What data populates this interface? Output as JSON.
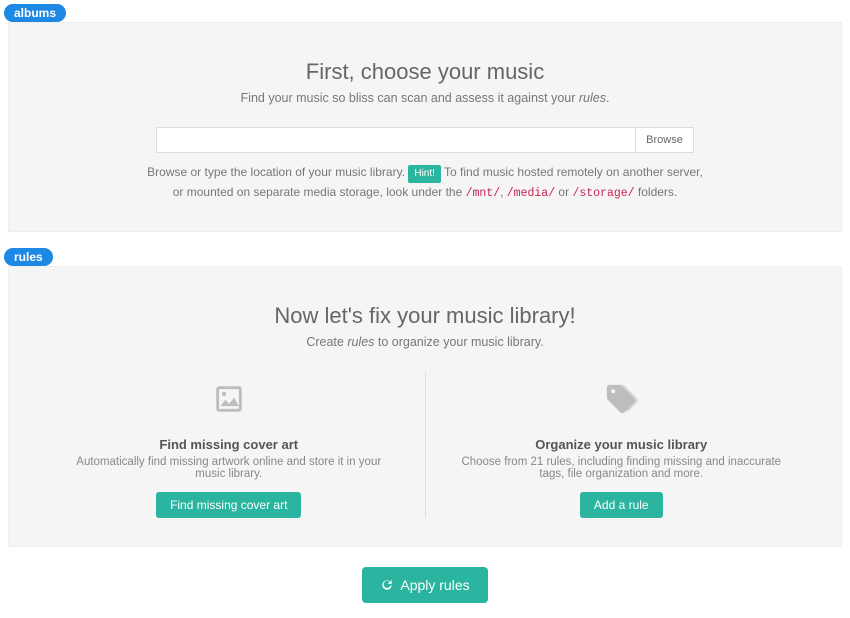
{
  "albums": {
    "tag": "albums",
    "title": "First, choose your music",
    "subtitle_pre": "Find your music so bliss can scan and assess it against your ",
    "subtitle_em": "rules",
    "subtitle_post": ".",
    "browse_label": "Browse",
    "hint_pre": "Browse or type the location of your music library. ",
    "hint_badge": "Hint!",
    "hint_mid": " To find music hosted remotely on another server, or mounted on separate media storage, look under the ",
    "path1": "/mnt/",
    "sep1": ", ",
    "path2": "/media/",
    "sep2": " or ",
    "path3": "/storage/",
    "hint_post": " folders."
  },
  "rules": {
    "tag": "rules",
    "title": "Now let's fix your music library!",
    "subtitle_pre": "Create ",
    "subtitle_em": "rules",
    "subtitle_post": " to organize your music library.",
    "left": {
      "heading": "Find missing cover art",
      "desc": "Automatically find missing artwork online and store it in your music library.",
      "button": "Find missing cover art"
    },
    "right": {
      "heading": "Organize your music library",
      "desc": "Choose from 21 rules, including finding missing and inaccurate tags, file organization and more.",
      "button": "Add a rule"
    }
  },
  "apply": {
    "label": "Apply rules"
  }
}
